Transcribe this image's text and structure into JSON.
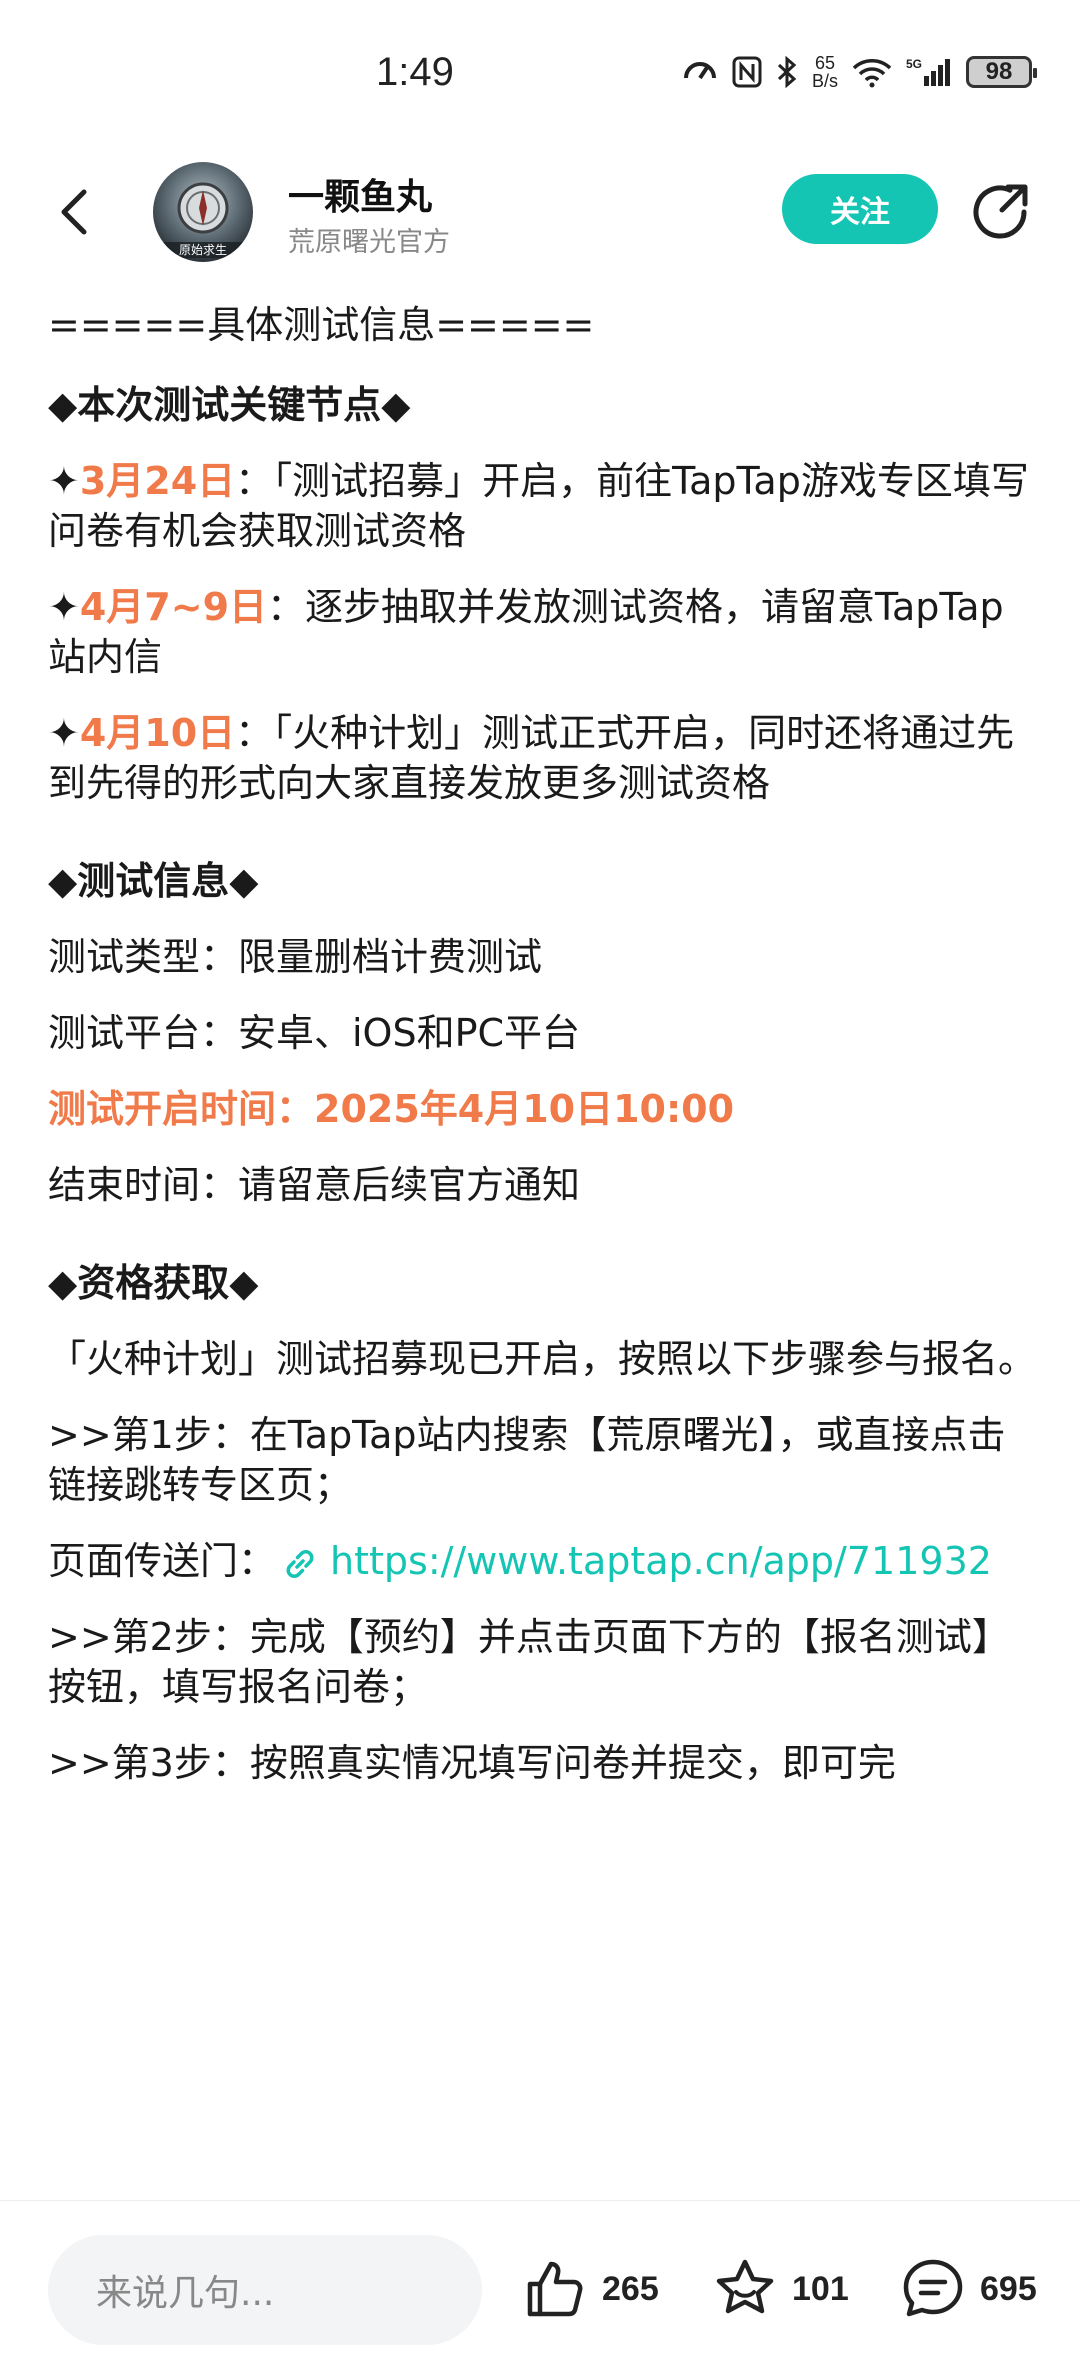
{
  "status_bar": {
    "time": "1:49",
    "net_speed_value": "65",
    "net_speed_unit": "B/s",
    "battery": "98",
    "icons": [
      "dnd-icon",
      "nfc-icon",
      "bluetooth-icon",
      "wifi-icon",
      "signal-5g-icon",
      "battery-icon"
    ]
  },
  "header": {
    "author_name": "一颗鱼丸",
    "author_subtitle": "荒原曙光官方",
    "follow_label": "关注",
    "avatar_badge": "原始求生",
    "accent_color": "#15c5b4"
  },
  "post": {
    "divider_title": "=====具体测试信息=====",
    "nodes_heading": "◆本次测试关键节点◆",
    "nodes": [
      {
        "bullet": "✦",
        "date": "3月24日",
        "text": "：「测试招募」开启，前往TapTap游戏专区填写问卷有机会获取测试资格"
      },
      {
        "bullet": "✦",
        "date": "4月7~9日",
        "text": "：逐步抽取并发放测试资格，请留意TapTap站内信"
      },
      {
        "bullet": "✦",
        "date": "4月10日",
        "text": "：「火种计划」测试正式开启，同时还将通过先到先得的形式向大家直接发放更多测试资格"
      }
    ],
    "info_heading": "◆测试信息◆",
    "info_type": "测试类型：限量删档计费测试",
    "info_platform": "测试平台：安卓、iOS和PC平台",
    "info_start": "测试开启时间：2025年4月10日10:00",
    "info_end": "结束时间：请留意后续官方通知",
    "qualify_heading": "◆资格获取◆",
    "qualify_intro": "「火种计划」测试招募现已开启，按照以下步骤参与报名。",
    "step1": ">>第1步：在TapTap站内搜索【荒原曙光】，或直接点击链接跳转专区页；",
    "portal_label": "页面传送门：",
    "portal_link": "https://www.taptap.cn/app/711932",
    "step2": ">>第2步：完成【预约】并点击页面下方的【报名测试】按钮，填写报名问卷；",
    "step3": ">>第3步：按照真实情况填写问卷并提交，即可完",
    "highlight_color": "#f07a49"
  },
  "bottom_bar": {
    "comment_placeholder": "来说几句...",
    "likes": "265",
    "favorites": "101",
    "comments": "695"
  }
}
